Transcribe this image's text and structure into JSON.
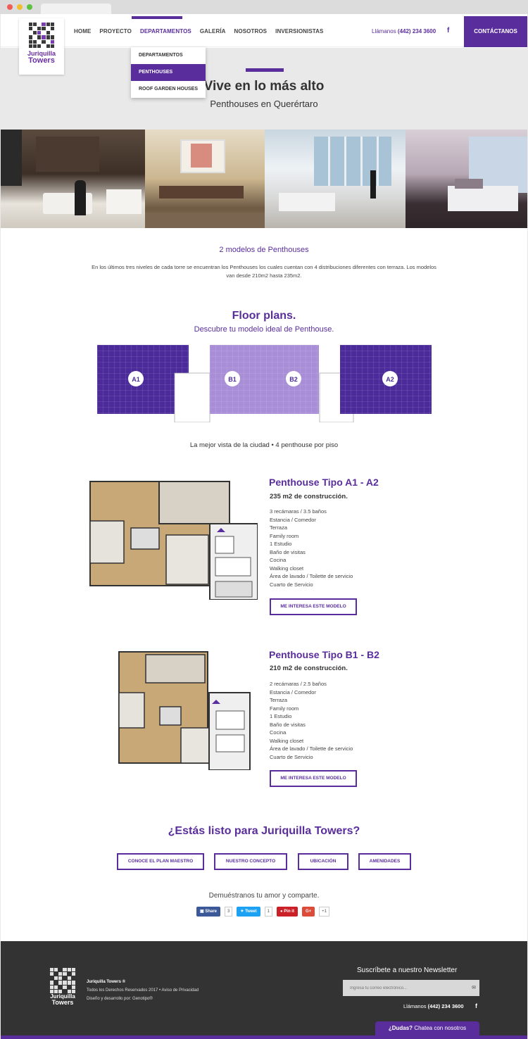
{
  "header": {
    "logo_line1": "Juriquilla",
    "logo_line2": "Towers",
    "nav": [
      "HOME",
      "PROYECTO",
      "DEPARTAMENTOS",
      "GALERÍA",
      "NOSOTROS",
      "INVERSIONISTAS"
    ],
    "phone_prefix": "Llámanos",
    "phone_number": "(442) 234 3600",
    "facebook_icon": "f",
    "contact_label": "CONTÁCTANOS"
  },
  "dropdown": [
    "DEPARTAMENTOS",
    "PENTHOUSES",
    "ROOF GARDEN HOUSES"
  ],
  "hero": {
    "title": "Vive en lo más alto",
    "subtitle": "Penthouses en Querértaro"
  },
  "intro": {
    "title": "2 modelos de Penthouses",
    "text": "En los últimos tres niveles de cada torre se encuentran los Penthouses los cuales cuentan con 4 distribuciones diferentes con terraza. Los modelos van desde 210m2 hasta 235m2."
  },
  "floorplans": {
    "title": "Floor plans.",
    "subtitle": "Descubre tu modelo ideal de Penthouse.",
    "labels": [
      "A1",
      "B1",
      "B2",
      "A2"
    ],
    "tagline": "La mejor vista de la ciudad • 4 penthouse por piso"
  },
  "model_a": {
    "title": "Penthouse Tipo A1 - A2",
    "size": "235 m2 de construcción.",
    "features": [
      "3 recámaras / 3.5 baños",
      "Estancia / Comedor",
      "Terraza",
      "Family room",
      "1 Estudio",
      "Baño de visitas",
      "Cocina",
      "Walking closet",
      "Área de lavado / Toilette de servicio",
      "Cuarto de Servicio"
    ],
    "button": "ME INTERESA ESTE MODELO"
  },
  "model_b": {
    "title": "Penthouse Tipo B1 - B2",
    "size": "210 m2 de construcción.",
    "features": [
      "2 recámaras / 2.5 baños",
      "Estancia / Comedor",
      "Terraza",
      "Family room",
      "1 Estudio",
      "Baño de visitas",
      "Cocina",
      "Walking closet",
      "Área de lavado / Toilette de servicio",
      "Cuarto de Servicio"
    ],
    "button": "ME INTERESA ESTE MODELO"
  },
  "cta": {
    "title": "¿Estás listo para Juriquilla Towers?",
    "buttons": [
      "CONOCE EL PLAN MAESTRO",
      "NUESTRO CONCEPTO",
      "UBICACIÓN",
      "AMENIDADES"
    ]
  },
  "share": {
    "title": "Demuéstranos tu amor y comparte.",
    "facebook": {
      "label": "Share",
      "count": "3",
      "color": "#3b5998"
    },
    "twitter": {
      "label": "Tweet",
      "count": "1",
      "color": "#1da1f2"
    },
    "pinterest": {
      "label": "Pin it",
      "color": "#cb2027"
    },
    "google": {
      "label": "G+",
      "count": "+1",
      "color": "#dd4b39"
    }
  },
  "footer": {
    "logo_line1": "Juriquilla",
    "logo_line2": "Towers",
    "brand": "Juriquilla Towers ®",
    "rights": "Todos los Derechos Reservados 2017 • Aviso de Privacidad",
    "credits": "Diseño y desarrollo por: Genotipo®",
    "newsletter_title": "Suscríbete a nuestro Newsletter",
    "newsletter_placeholder": "Ingresa tu correo electrónico...",
    "phone_prefix": "Llámanos",
    "phone_number": "(442) 234 3600",
    "facebook_icon": "f",
    "chat_bold": "¿Dudas?",
    "chat_text": "Chatea con nosotros"
  },
  "colors": {
    "brand": "#5a2d9c",
    "footer": "#333334",
    "hero_bg": "#e9e9ea"
  }
}
